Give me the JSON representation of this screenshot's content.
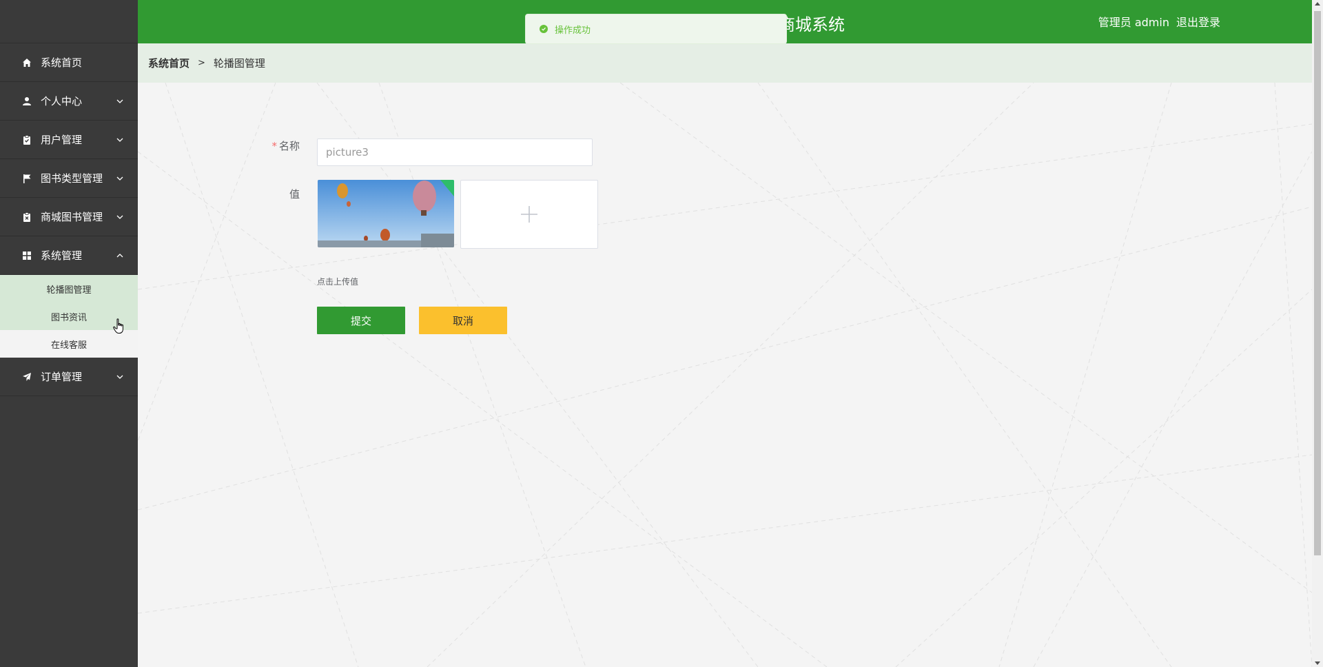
{
  "header": {
    "title": "商城系统",
    "user_label": "管理员 admin",
    "logout_label": "退出登录"
  },
  "toast": {
    "message": "操作成功"
  },
  "sidebar": {
    "items": [
      {
        "label": "系统首页",
        "icon": "home-icon"
      },
      {
        "label": "个人中心",
        "icon": "user-icon"
      },
      {
        "label": "用户管理",
        "icon": "clipboard-icon"
      },
      {
        "label": "图书类型管理",
        "icon": "flag-icon"
      },
      {
        "label": "商城图书管理",
        "icon": "clipboard-x-icon"
      },
      {
        "label": "系统管理",
        "icon": "grid-icon"
      },
      {
        "label": "订单管理",
        "icon": "send-icon"
      }
    ],
    "submenu": [
      "轮播图管理",
      "图书资讯",
      "在线客服"
    ]
  },
  "breadcrumb": {
    "home": "系统首页",
    "separator": ">",
    "current": "轮播图管理"
  },
  "form": {
    "name_label": "名称",
    "required_mark": "*",
    "name_value": "picture3",
    "value_label": "值",
    "upload_tip": "点击上传值",
    "submit_label": "提交",
    "cancel_label": "取消"
  },
  "colors": {
    "primary": "#319a32",
    "cancel": "#fbc02d",
    "sidebar": "#3a3a3a"
  }
}
